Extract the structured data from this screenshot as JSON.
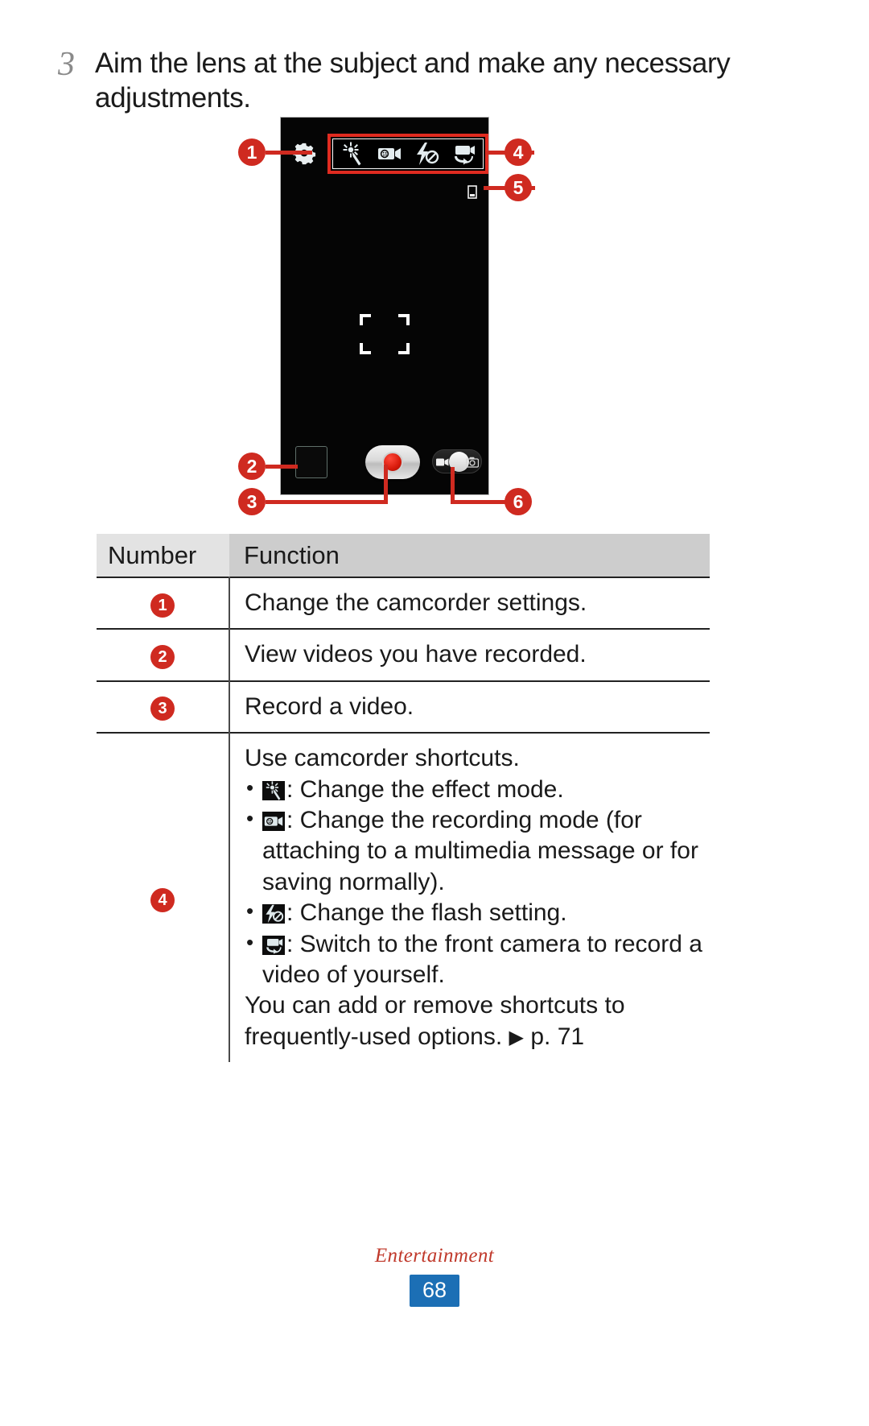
{
  "step": {
    "number": "3",
    "text": "Aim the lens at the subject and make any necessary adjustments."
  },
  "figure": {
    "callouts": [
      {
        "id": "1",
        "label": "1"
      },
      {
        "id": "2",
        "label": "2"
      },
      {
        "id": "3",
        "label": "3"
      },
      {
        "id": "4",
        "label": "4"
      },
      {
        "id": "5",
        "label": "5"
      },
      {
        "id": "6",
        "label": "6"
      }
    ],
    "phone_ui": {
      "settings_icon": "gear-icon",
      "shortcuts": [
        "effect-mode-icon",
        "recording-mode-icon",
        "flash-off-icon",
        "switch-camera-icon"
      ],
      "status_indicator": "storage-indicator-icon",
      "focus_frame": "focus-brackets",
      "gallery_thumbnail": "gallery-thumbnail",
      "record_button": "record-button",
      "mode_toggle": {
        "video_icon": "camcorder-icon",
        "photo_icon": "camera-icon"
      }
    }
  },
  "table": {
    "headers": {
      "number": "Number",
      "function": "Function"
    },
    "rows": [
      {
        "number": "1",
        "function": "Change the camcorder settings."
      },
      {
        "number": "2",
        "function": "View videos you have recorded."
      },
      {
        "number": "3",
        "function": "Record a video."
      }
    ],
    "row4": {
      "number": "4",
      "title": "Use camcorder shortcuts.",
      "bullets": [
        {
          "icon": "effect-mode-icon",
          "text": ": Change the effect mode."
        },
        {
          "icon": "recording-mode-icon",
          "text": ": Change the recording mode (for attaching to a multimedia message or for saving normally)."
        },
        {
          "icon": "flash-off-icon",
          "text": ": Change the flash setting."
        },
        {
          "icon": "switch-camera-icon",
          "text": ": Switch to the front camera to record a video of yourself."
        }
      ],
      "tail_before": "You can add or remove shortcuts to frequently-used options.",
      "tail_arrow": "▶",
      "tail_after": "p. 71"
    }
  },
  "footer": {
    "section": "Entertainment",
    "page": "68"
  },
  "colors": {
    "accent_red": "#cf2a20",
    "page_badge_blue": "#1c6fb5",
    "footer_red": "#c0392b",
    "header_num_bg": "#e3e3e3",
    "header_fn_bg": "#cdcdcd"
  }
}
